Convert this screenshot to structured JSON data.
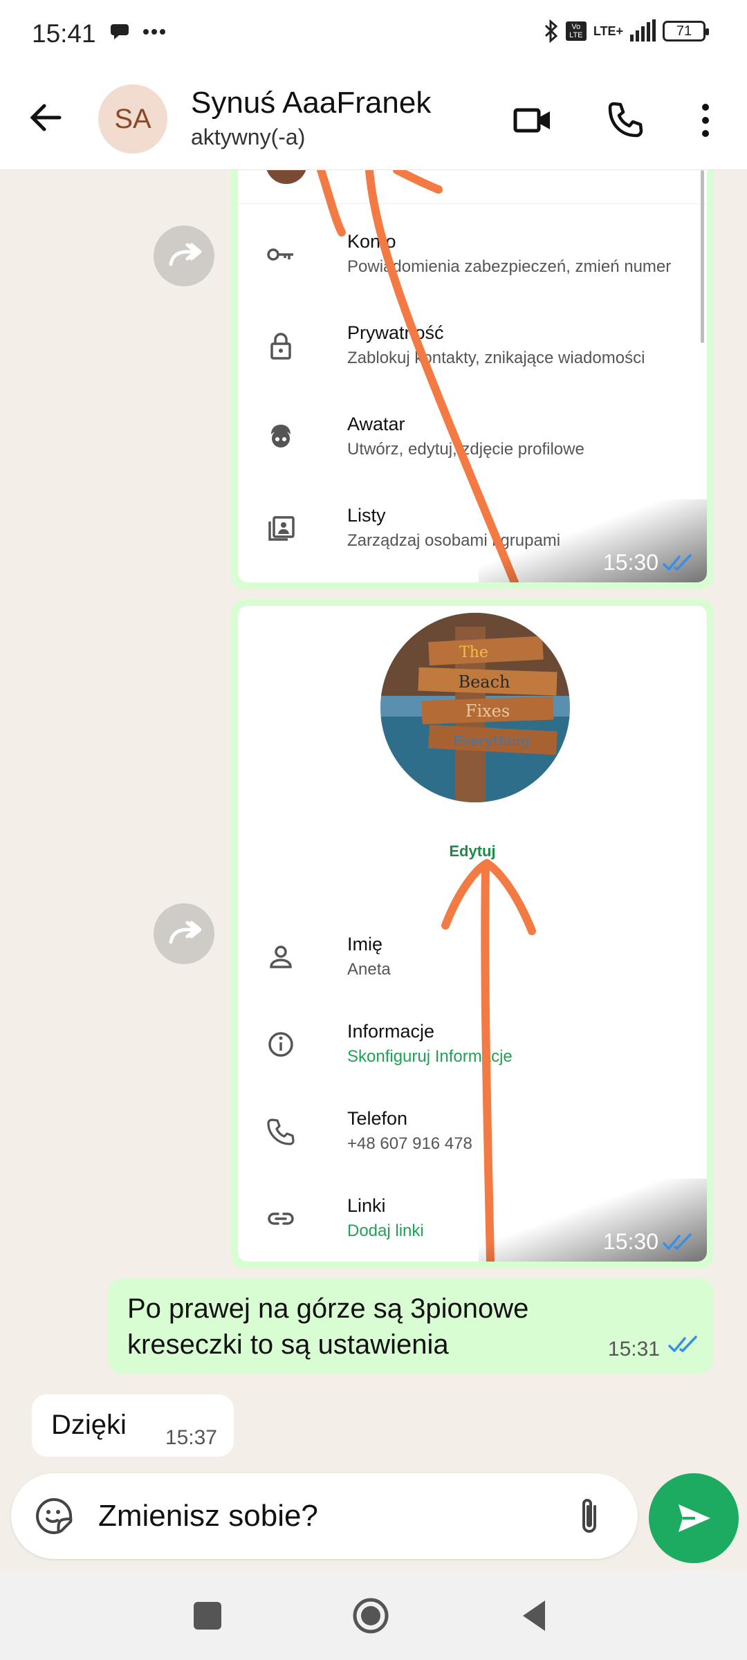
{
  "status_bar": {
    "time": "15:41",
    "network": "LTE+",
    "volte": "Vo LTE",
    "battery": "71"
  },
  "header": {
    "avatar_initials": "SA",
    "contact_name": "Synuś AaaFranek",
    "contact_status": "aktywny(-a)"
  },
  "settings_shot": {
    "items": [
      {
        "title": "Konto",
        "subtitle": "Powiadomienia zabezpieczeń, zmień numer"
      },
      {
        "title": "Prywatność",
        "subtitle": "Zablokuj kontakty, znikające wiadomości"
      },
      {
        "title": "Awatar",
        "subtitle": "Utwórz, edytuj, zdjęcie profilowe"
      },
      {
        "title": "Listy",
        "subtitle": "Zarządzaj osobami i grupami"
      }
    ],
    "time": "15:30"
  },
  "profile_shot": {
    "edit_label": "Edytuj",
    "sign_words": [
      "The",
      "Beach",
      "Fixes",
      "Everything"
    ],
    "items": [
      {
        "title": "Imię",
        "subtitle": "Aneta"
      },
      {
        "title": "Informacje",
        "subtitle": "Skonfiguruj Informacje"
      },
      {
        "title": "Telefon",
        "subtitle": "+48 607 916 478"
      },
      {
        "title": "Linki",
        "subtitle": "Dodaj linki"
      }
    ],
    "time": "15:30"
  },
  "messages": {
    "outgoing": {
      "text": "Po prawej na górze są 3pionowe kreseczki to są ustawienia",
      "time": "15:31"
    },
    "incoming": {
      "text": "Dzięki",
      "time": "15:37"
    }
  },
  "composer": {
    "value": "Zmienisz sobie?"
  },
  "colors": {
    "accent": "#1daa61",
    "bubble_out": "#d9fdd3",
    "chat_bg": "#f3efe8",
    "annotation": "#f47a44",
    "read_ticks": "#3a8ee6"
  }
}
